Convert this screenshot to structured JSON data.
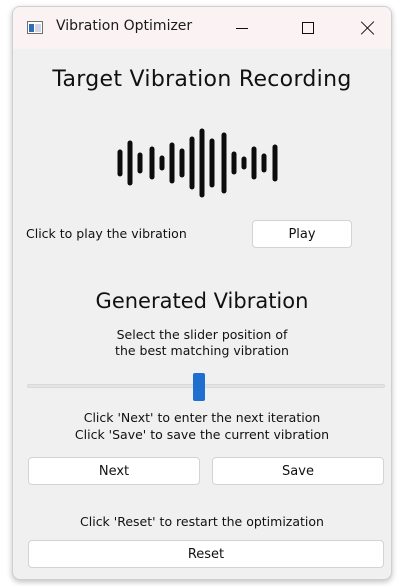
{
  "window": {
    "title": "Vibration Optimizer"
  },
  "target": {
    "heading": "Target Vibration Recording",
    "play_hint": "Click to play the vibration",
    "play_label": "Play"
  },
  "generated": {
    "heading": "Generated Vibration",
    "instruction_line1": "Select the slider position of",
    "instruction_line2": "the best matching vibration",
    "slider_position": 0.48,
    "hint_next": "Click 'Next' to enter the next iteration",
    "hint_save": "Click 'Save' to save the current vibration",
    "next_label": "Next",
    "save_label": "Save",
    "reset_hint": "Click 'Reset' to restart the optimization",
    "reset_label": "Reset"
  },
  "icons": {
    "app": "app-window-icon",
    "waveform": "waveform-icon",
    "minimize": "minimize-icon",
    "maximize": "maximize-icon",
    "close": "close-icon"
  },
  "colors": {
    "titlebar": "#fbf3f3",
    "window_bg": "#f0f0f0",
    "slider_thumb": "#1f6fd1"
  }
}
